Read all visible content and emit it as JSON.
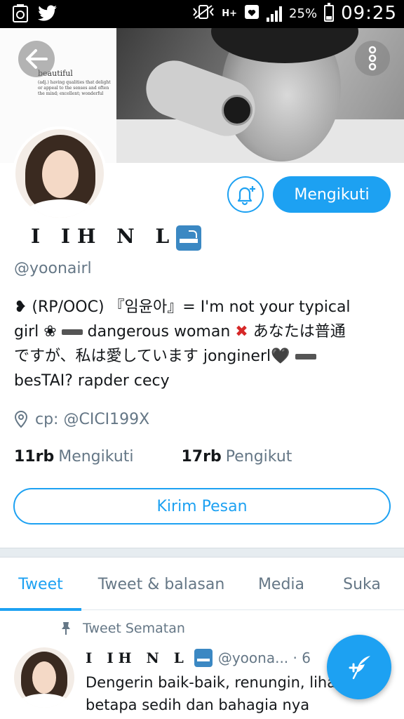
{
  "status_bar": {
    "battery": "25%",
    "time": "09:25",
    "network": "H+",
    "battery_level": 0.25
  },
  "header": {
    "quote_word": "beautiful",
    "quote_definition": "(adj.) having qualities that delight or appeal to the senses and often the mind; excellent; wonderful"
  },
  "profile": {
    "display_name": "I IH N L",
    "handle": "@yoonairl",
    "bio_line1_prefix": "❥ (RP/OOC) 『임윤아』= I'm not your typical",
    "bio_line2_a": "girl ❀ ",
    "bio_line2_b": " dangerous woman ",
    "bio_cross": "✖",
    "bio_line2_c": " あなたは普通",
    "bio_line3": "ですが、私は愛しています jonginerl🖤 ",
    "bio_line4": "besTAI? rapder cecy",
    "location": "cp: @CICI199X",
    "following_count": "11rb",
    "following_label": "Mengikuti",
    "followers_count": "17rb",
    "followers_label": "Pengikut"
  },
  "buttons": {
    "follow_label": "Mengikuti",
    "message_label": "Kirim Pesan"
  },
  "tabs": [
    {
      "label": "Tweet",
      "active": true
    },
    {
      "label": "Tweet & balasan",
      "active": false
    },
    {
      "label": "Media",
      "active": false
    },
    {
      "label": "Suka",
      "active": false
    }
  ],
  "pinned_tweet": {
    "pin_label": "Tweet Sematan",
    "name": "I IH N L",
    "handle": "@yoona... · 6",
    "text": "Dengerin baik-baik, renungin, lihat betapa sedih dan bahagia nya"
  },
  "colors": {
    "accent": "#1da1f2",
    "muted": "#657786",
    "text": "#14171a"
  },
  "icons": {
    "back": "arrow-left-icon",
    "more": "more-vertical-icon",
    "bell": "bell-plus-icon",
    "location": "location-pin-icon",
    "pin": "pin-icon",
    "compose": "compose-feather-icon"
  }
}
